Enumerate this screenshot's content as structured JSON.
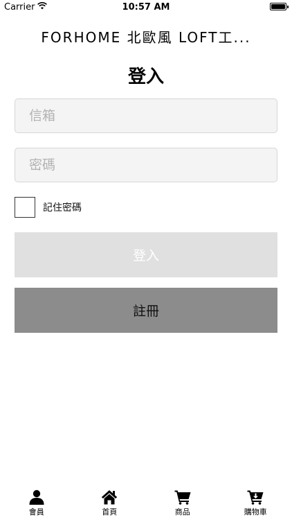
{
  "status_bar": {
    "carrier": "Carrier",
    "time": "10:57 AM",
    "wifi_icon": "wifi-icon",
    "battery_icon": "battery-icon"
  },
  "header": {
    "title": "FORHOME 北歐風 LOFT工..."
  },
  "login": {
    "title": "登入",
    "email_placeholder": "信箱",
    "email_value": "",
    "password_placeholder": "密碼",
    "password_value": "",
    "remember_label": "記住密碼",
    "remember_checked": false,
    "login_button": "登入",
    "register_button": "註冊"
  },
  "tabbar": {
    "items": [
      {
        "label": "會員",
        "icon": "user-icon"
      },
      {
        "label": "首頁",
        "icon": "home-icon"
      },
      {
        "label": "商品",
        "icon": "cart-icon"
      },
      {
        "label": "購物車",
        "icon": "cart-add-icon"
      }
    ]
  },
  "colors": {
    "input_bg": "#f4f4f4",
    "login_button_bg": "#e0e0e0",
    "register_button_bg": "#8c8c8c"
  }
}
